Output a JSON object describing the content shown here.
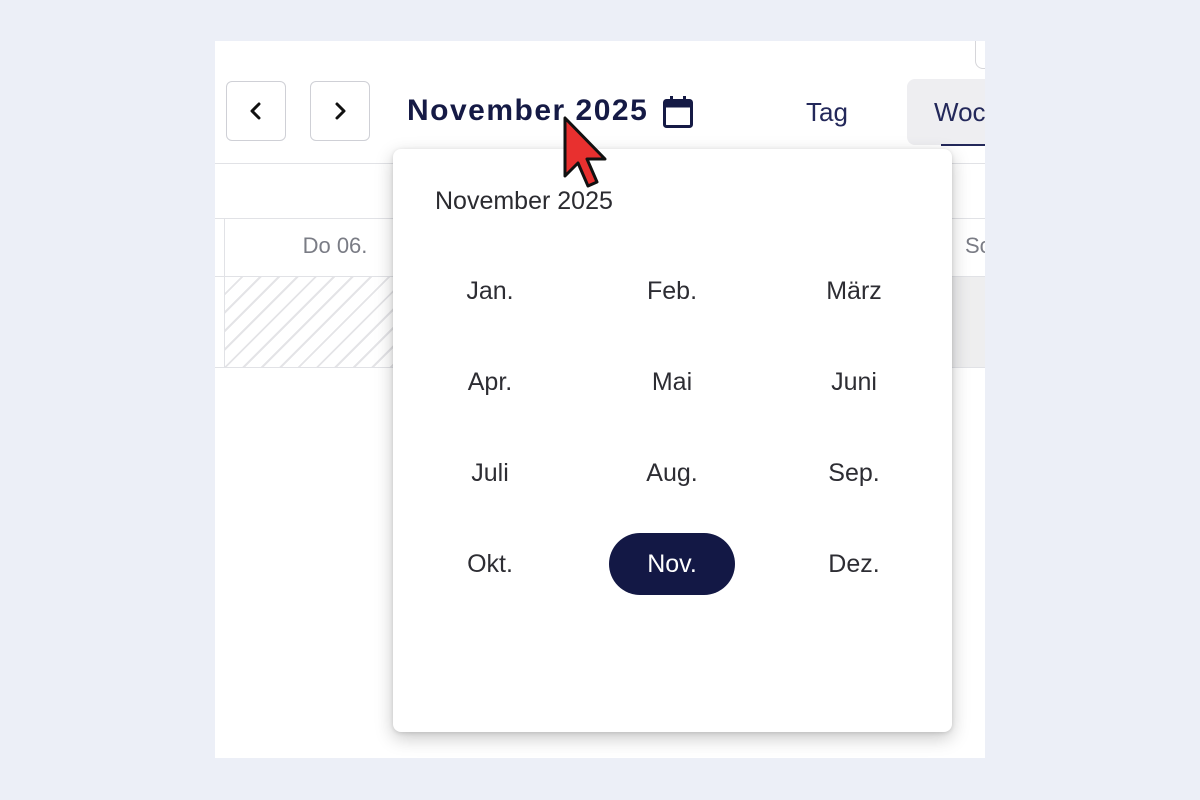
{
  "toolbar": {
    "prev_icon": "chevron-left-icon",
    "next_icon": "chevron-right-icon",
    "current_period": "November 2025",
    "calendar_icon": "calendar-icon",
    "views": [
      {
        "label": "Tag",
        "active": false
      },
      {
        "label": "Woc",
        "active": true
      }
    ]
  },
  "grid": {
    "day_headers": [
      "Do 06.",
      "Sc"
    ]
  },
  "month_picker": {
    "title": "November 2025",
    "months": [
      "Jan.",
      "Feb.",
      "März",
      "Apr.",
      "Mai",
      "Juni",
      "Juli",
      "Aug.",
      "Sep.",
      "Okt.",
      "Nov.",
      "Dez."
    ],
    "selected": "Nov."
  },
  "colors": {
    "accent": "#131845",
    "background": "#eceff7",
    "cursor": "#e8302f"
  }
}
